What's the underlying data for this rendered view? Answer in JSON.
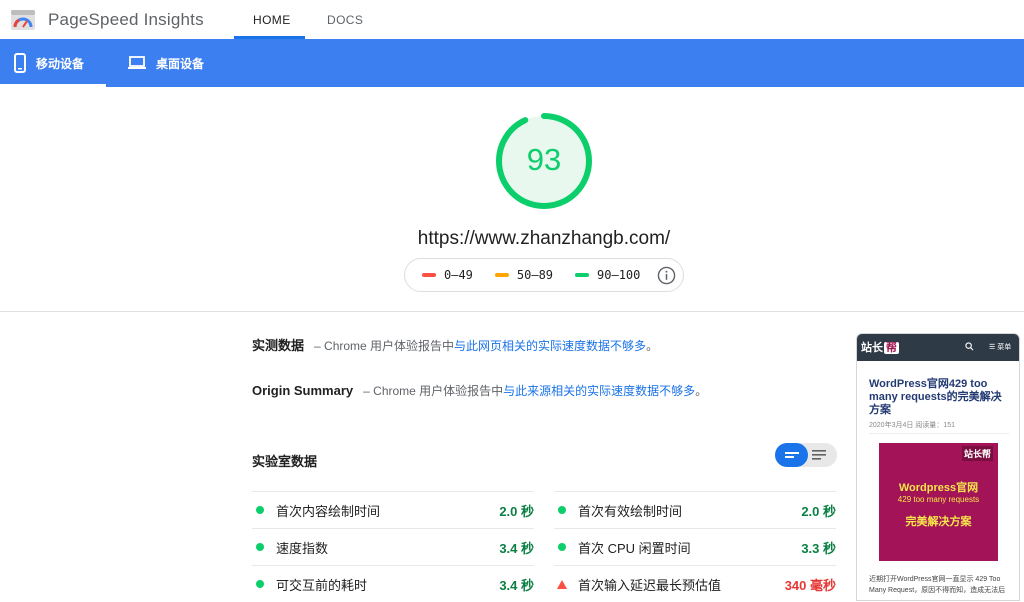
{
  "app": {
    "title": "PageSpeed Insights"
  },
  "nav": {
    "tabs": [
      {
        "label": "HOME"
      },
      {
        "label": "DOCS"
      }
    ]
  },
  "device_tabs": [
    {
      "label": "移动设备",
      "icon": "phone-icon"
    },
    {
      "label": "桌面设备",
      "icon": "laptop-icon"
    }
  ],
  "summary": {
    "score": "93",
    "score_fraction": 0.93,
    "url": "https://www.zhanzhangb.com/"
  },
  "legend": {
    "items": [
      {
        "label": "0–49",
        "color": "#ff4e42"
      },
      {
        "label": "50–89",
        "color": "#ffa400"
      },
      {
        "label": "90–100",
        "color": "#0cce6b"
      }
    ]
  },
  "field_data": {
    "label": "实测数据",
    "prefix": "– Chrome 用户体验报告中",
    "link": "与此网页相关的实际速度数据不够多",
    "suffix": "。"
  },
  "origin_summary": {
    "label": "Origin Summary",
    "prefix": "– Chrome 用户体验报告中",
    "link": "与此来源相关的实际速度数据不够多",
    "suffix": "。"
  },
  "lab_data": {
    "title": "实验室数据",
    "metrics": [
      {
        "name": "首次内容绘制时间",
        "value": "2.0 秒",
        "status": "good"
      },
      {
        "name": "首次有效绘制时间",
        "value": "2.0 秒",
        "status": "good"
      },
      {
        "name": "速度指数",
        "value": "3.4 秒",
        "status": "good"
      },
      {
        "name": "首次 CPU 闲置时间",
        "value": "3.3 秒",
        "status": "good"
      },
      {
        "name": "可交互前的耗时",
        "value": "3.4 秒",
        "status": "good"
      },
      {
        "name": "首次输入延迟最长预估值",
        "value": "340 毫秒",
        "status": "bad"
      }
    ]
  },
  "thumbnail": {
    "logo": "站长",
    "logo_badge": "帮",
    "menu": "☰ 菜单",
    "title": "WordPress官网429 too many requests的完美解决方案",
    "meta": "2020年3月4日  阅读量：151",
    "image_badge": "站长帮",
    "image_lines": [
      "Wordpress官网",
      "429 too many requests",
      "完美解决方案"
    ],
    "body": "近期打开WordPress官网一直显示 429 Too Many Request，原因不得而知，造成无法后"
  },
  "colors": {
    "accent": "#1a73e8",
    "bar": "#3c7ff0",
    "good": "#0cce6b",
    "bad": "#ff4e42",
    "average": "#ffa400"
  }
}
